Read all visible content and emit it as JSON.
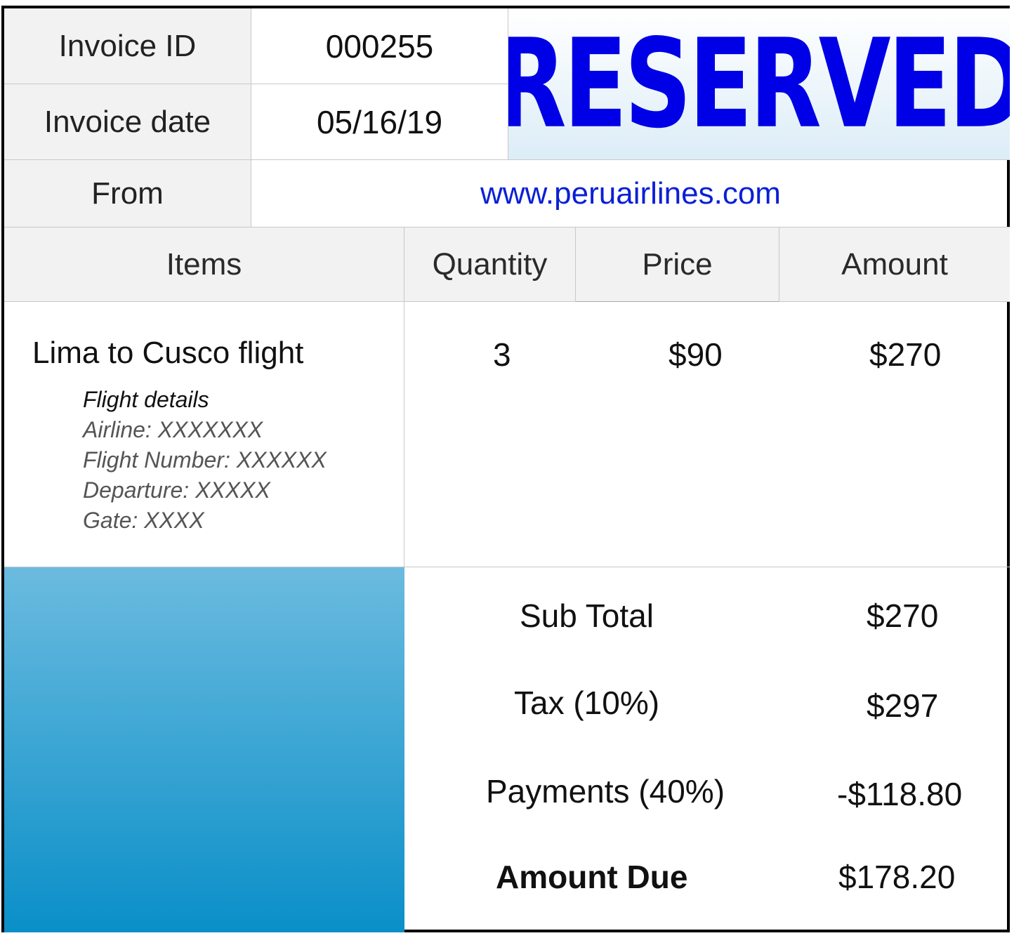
{
  "invoice": {
    "id_label": "Invoice ID",
    "id_value": "000255",
    "date_label": "Invoice date",
    "date_value": "05/16/19",
    "from_label": "From",
    "from_value": "www.peruairlines.com",
    "stamp": "RESERVED"
  },
  "table": {
    "headers": [
      "Items",
      "Quantity",
      "Price",
      "Amount"
    ],
    "rows": [
      {
        "item": "Lima to Cusco flight",
        "details_title": "Flight details",
        "details": [
          "Airline: XXXXXXX",
          "Flight Number: XXXXXX",
          "Departure: XXXXX",
          "Gate: XXXX"
        ],
        "quantity": "3",
        "price": "$90",
        "amount": "$270"
      }
    ]
  },
  "totals": {
    "subtotal_label": "Sub Total",
    "subtotal_value": "$270",
    "tax_label": "Tax (10%)",
    "tax_value": "$297",
    "payments_label": "Payments (40%)",
    "payments_value": "-$118.80",
    "due_label": "Amount Due",
    "due_value": "$178.20"
  },
  "colors": {
    "stamp": "#0000e6",
    "link": "#0a1fd6",
    "panel_top": "#6bbbdf",
    "panel_bottom": "#0a8fc8"
  }
}
